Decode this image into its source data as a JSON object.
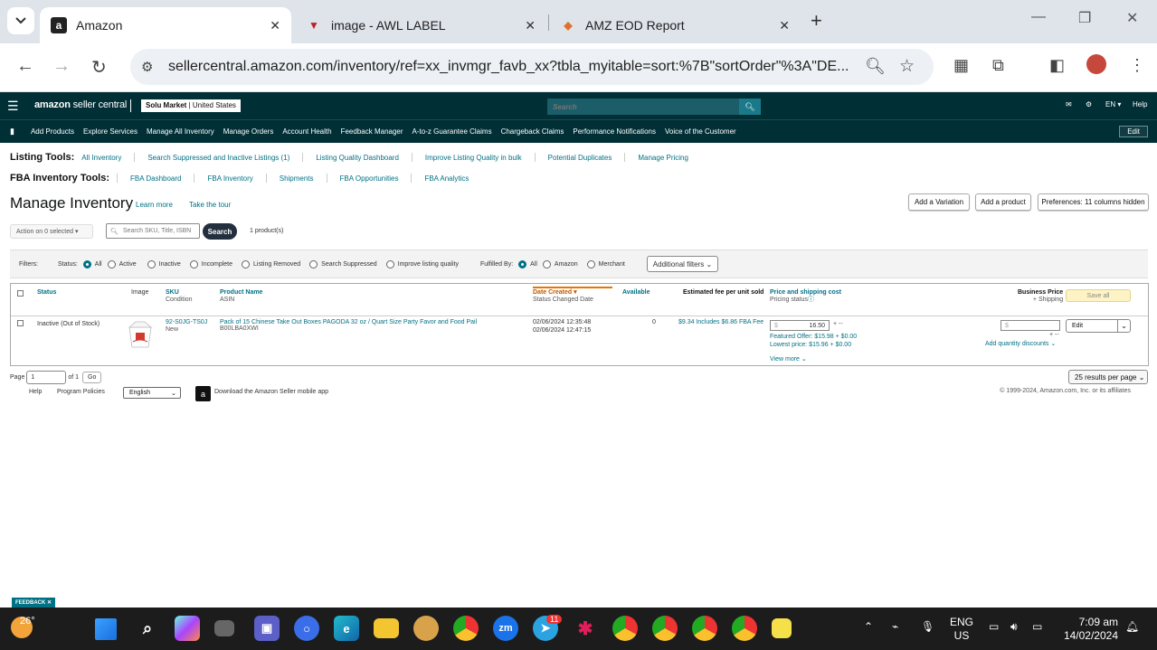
{
  "browser": {
    "tabs": [
      {
        "title": "Amazon",
        "icon": "amazon-icon",
        "active": true
      },
      {
        "title": "image - AWL LABEL",
        "icon": "awl-icon",
        "active": false
      },
      {
        "title": "AMZ EOD Report",
        "icon": "report-icon",
        "active": false
      }
    ],
    "url": "sellercentral.amazon.com/inventory/ref=xx_invmgr_favb_xx?tbla_myitable=sort:%7B\"sortOrder\"%3A\"DE..."
  },
  "seller_header": {
    "logo_bold": "amazon",
    "logo_text": " seller central",
    "store": "Solu Market",
    "marketplace": "United States",
    "search_placeholder": "Search",
    "lang": "EN",
    "help": "Help"
  },
  "nav": {
    "items": [
      "Add Products",
      "Explore Services",
      "Manage All Inventory",
      "Manage Orders",
      "Account Health",
      "Feedback Manager",
      "A-to-z Guarantee Claims",
      "Chargeback Claims",
      "Performance Notifications",
      "Voice of the Customer"
    ],
    "edit": "Edit"
  },
  "listing_tools": {
    "label": "Listing Tools:",
    "links": [
      "All Inventory",
      "Search Suppressed and Inactive Listings (1)",
      "Listing Quality Dashboard",
      "Improve Listing Quality in bulk",
      "Potential Duplicates",
      "Manage Pricing"
    ]
  },
  "fba_tools": {
    "label": "FBA Inventory Tools:",
    "links": [
      "FBA Dashboard",
      "FBA Inventory",
      "Shipments",
      "FBA Opportunities",
      "FBA Analytics"
    ]
  },
  "page": {
    "title": "Manage Inventory",
    "learn_more": "Learn more",
    "tour": "Take the tour",
    "add_variation": "Add a Variation",
    "add_product": "Add a product",
    "preferences": "Preferences: 11 columns hidden",
    "action": "Action on 0 selected",
    "search_placeholder": "Search SKU, Title, ISBN",
    "search_btn": "Search",
    "product_count": "1 product(s)"
  },
  "filters": {
    "label": "Filters:",
    "status_label": "Status:",
    "status_options": [
      "All",
      "Active",
      "Inactive",
      "Incomplete",
      "Listing Removed",
      "Search Suppressed",
      "Improve listing quality"
    ],
    "fulfilled_label": "Fulfilled By:",
    "fulfilled_options": [
      "All",
      "Amazon",
      "Merchant"
    ],
    "additional": "Additional filters"
  },
  "table": {
    "headers": {
      "status": "Status",
      "image": "Image",
      "sku": "SKU",
      "condition": "Condition",
      "product_name": "Product Name",
      "asin": "ASIN",
      "date_created": "Date Created",
      "status_changed": "Status Changed Date",
      "available": "Available",
      "est_fee": "Estimated fee per unit sold",
      "price": "Price and shipping cost",
      "pricing_status": "Pricing status",
      "business_price": "Business Price",
      "shipping": "+ Shipping",
      "save_all": "Save all"
    },
    "row": {
      "status": "Inactive (Out of Stock)",
      "sku": "92-S0JG-TS0J",
      "condition": "New",
      "product_name": "Pack of 15 Chinese Take Out Boxes PAGODA 32 oz / Quart Size Party Favor and Food Pail",
      "asin": "B00LBA0XWI",
      "date_created": "02/06/2024 12:35:48",
      "status_changed": "02/06/2024 12:47:15",
      "available": "0",
      "est_fee": "$9.34 Includes $6.86 FBA Fee",
      "price": "16.50",
      "price_symbol": "$",
      "featured_offer": "Featured Offer: $15.98 + $0.00",
      "lowest_price": "Lowest price: $15.96 + $0.00",
      "view_more": "View more",
      "business_symbol": "$",
      "qty_discounts": "Add quantity discounts",
      "edit": "Edit"
    }
  },
  "pager": {
    "page_label": "Page",
    "page": "1",
    "of": "of 1",
    "go": "Go",
    "per_page": "25 results per page"
  },
  "footer": {
    "help": "Help",
    "policies": "Program Policies",
    "language": "English",
    "app": "Download the Amazon Seller mobile app",
    "copyright": "© 1999-2024, Amazon.com, Inc. or its affiliates"
  },
  "feedback": "FEEDBACK",
  "taskbar": {
    "temp": "26°",
    "lang1": "ENG",
    "lang2": "US",
    "time": "7:09 am",
    "date": "14/02/2024",
    "telegram_badge": "11"
  },
  "colors": {
    "seller_bar": "#002f36",
    "link": "#007185",
    "taskbar": "#1c1c1c"
  }
}
